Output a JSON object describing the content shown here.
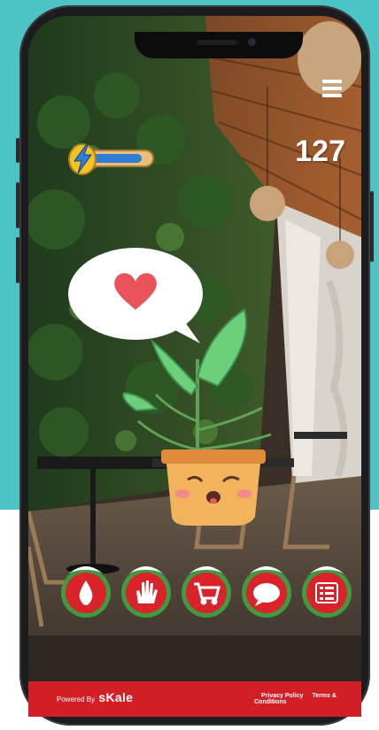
{
  "hud": {
    "score": "127",
    "energy_level": 0.86
  },
  "pet": {
    "speech_icon": "heart-icon",
    "mood": "sleepy"
  },
  "actions": [
    {
      "name": "water-button",
      "icon": "water-drop-icon"
    },
    {
      "name": "pet-button",
      "icon": "hand-icon"
    },
    {
      "name": "shop-button",
      "icon": "cart-icon"
    },
    {
      "name": "chat-button",
      "icon": "speech-bubble-icon"
    },
    {
      "name": "list-button",
      "icon": "list-icon"
    }
  ],
  "footer": {
    "powered_by": "Powered By",
    "brand": "sKale",
    "privacy": "Privacy Policy",
    "terms": "Terms & Conditions"
  },
  "colors": {
    "teal": "#4cc3c4",
    "footer_red": "#d21f26",
    "button_red": "#d8232a",
    "button_ring": "#4caf50",
    "energy_blue": "#2f7dd6"
  }
}
